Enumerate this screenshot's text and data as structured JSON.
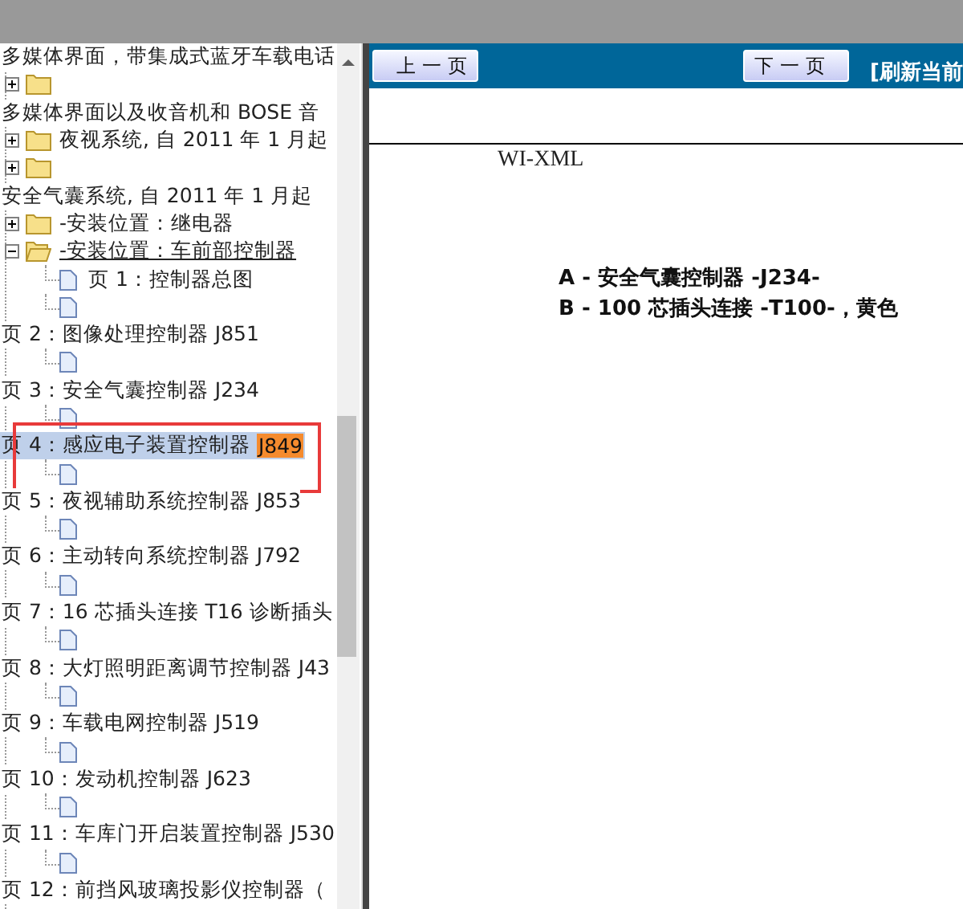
{
  "tree": {
    "rows": [
      {
        "kind": "text",
        "label": "多媒体界面，带集成式蓝牙车载电话",
        "selected": false
      },
      {
        "kind": "folder",
        "expanded": false,
        "selected": false
      },
      {
        "kind": "text",
        "label": "多媒体界面以及收音机和 BOSE 音",
        "selected": false
      },
      {
        "kind": "folder",
        "label": "夜视系统, 自 2011 年 1 月起",
        "expanded": false,
        "selected": false
      },
      {
        "kind": "folder",
        "expanded": false,
        "selected": false
      },
      {
        "kind": "text",
        "label": "安全气囊系统, 自 2011 年 1 月起",
        "selected": false
      },
      {
        "kind": "folder",
        "label": "-安装位置：继电器",
        "expanded": false,
        "selected": false
      },
      {
        "kind": "folder",
        "label": "-安装位置：车前部控制器",
        "expanded": true,
        "focused": true,
        "selected": false
      },
      {
        "kind": "doc",
        "label": "页 1：控制器总图",
        "selected": false
      },
      {
        "kind": "doc",
        "selected": false
      },
      {
        "kind": "text",
        "label": "页 2：图像处理控制器 J851",
        "selected": false
      },
      {
        "kind": "doc",
        "selected": false
      },
      {
        "kind": "text",
        "label": "页 3：安全气囊控制器 J234",
        "selected": false
      },
      {
        "kind": "doc",
        "selected": false
      },
      {
        "kind": "text",
        "label": "页 4：感应电子装置控制器",
        "highlight": "J849",
        "marked": true,
        "selected": true
      },
      {
        "kind": "doc",
        "selected": false
      },
      {
        "kind": "text",
        "label": "页 5：夜视辅助系统控制器 J853",
        "selected": false
      },
      {
        "kind": "doc",
        "selected": false
      },
      {
        "kind": "text",
        "label": "页 6：主动转向系统控制器 J792",
        "selected": false
      },
      {
        "kind": "doc",
        "selected": false
      },
      {
        "kind": "text",
        "label": "页 7：16 芯插头连接 T16 诊断插头",
        "selected": false
      },
      {
        "kind": "doc",
        "selected": false
      },
      {
        "kind": "text",
        "label": "页 8：大灯照明距离调节控制器 J43",
        "selected": false
      },
      {
        "kind": "doc",
        "selected": false
      },
      {
        "kind": "text",
        "label": "页 9：车载电网控制器 J519",
        "selected": false
      },
      {
        "kind": "doc",
        "selected": false
      },
      {
        "kind": "text",
        "label": "页 10：发动机控制器 J623",
        "selected": false
      },
      {
        "kind": "doc",
        "selected": false
      },
      {
        "kind": "text",
        "label": "页 11：车库门开启装置控制器 J530",
        "selected": false
      },
      {
        "kind": "doc",
        "selected": false
      },
      {
        "kind": "text",
        "label": "页 12：前挡风玻璃投影仪控制器（",
        "selected": false
      }
    ]
  },
  "viewer": {
    "prev_button": "上 一 页",
    "next_button": "下 一 页",
    "refresh_link": "[刷新当前",
    "doc_label": "WI-XML",
    "legend": [
      "A - 安全气囊控制器 -J234-",
      "B - 100 芯插头连接 -T100-，黄色"
    ]
  }
}
